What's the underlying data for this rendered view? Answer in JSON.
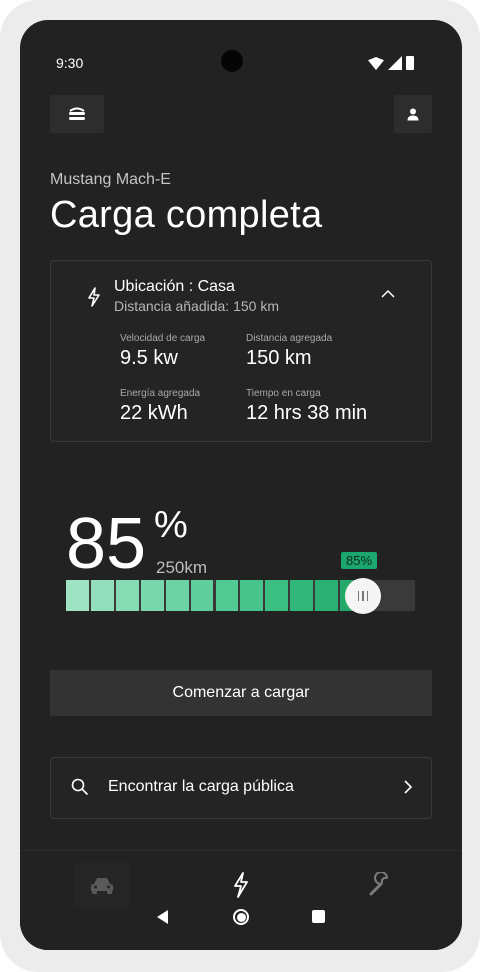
{
  "status_bar": {
    "time": "9:30"
  },
  "header": {
    "vehicle_name": "Mustang Mach-E",
    "title": "Carga completa"
  },
  "charge_card": {
    "location": "Ubicación : Casa",
    "distance_added_line": "Distancia añadida:  150 km",
    "stats": [
      {
        "label": "Velocidad de carga",
        "value": "9.5 kw"
      },
      {
        "label": "Distancia agregada",
        "value": "150 km"
      },
      {
        "label": "Energía agregada",
        "value": "22 kWh"
      },
      {
        "label": "Tiempo en carga",
        "value": "12 hrs 38 min"
      }
    ]
  },
  "battery": {
    "percent": "85",
    "percent_sign": "%",
    "range": "250km",
    "slider_badge": "85%",
    "slider_level": 0.85,
    "segment_colors": [
      "#9fe3c4",
      "#93dfbd",
      "#86dbb5",
      "#79d7ad",
      "#6cd3a5",
      "#60cf9d",
      "#52ca94",
      "#46c48b",
      "#3abe82",
      "#31b77a",
      "#29b072",
      "#24a96b"
    ]
  },
  "actions": {
    "start_label": "Comenzar a cargar",
    "find_label": "Encontrar la carga pública"
  },
  "colors": {
    "accent": "#1aa66c",
    "background": "#222222",
    "card_border": "#3a3a3a"
  },
  "icons": {
    "menu": "car-front-icon",
    "profile": "person-icon",
    "bolt": "lightning-bolt-icon",
    "search": "search-icon",
    "nav": [
      "car-icon",
      "lightning-bolt-icon",
      "wrench-icon"
    ]
  }
}
